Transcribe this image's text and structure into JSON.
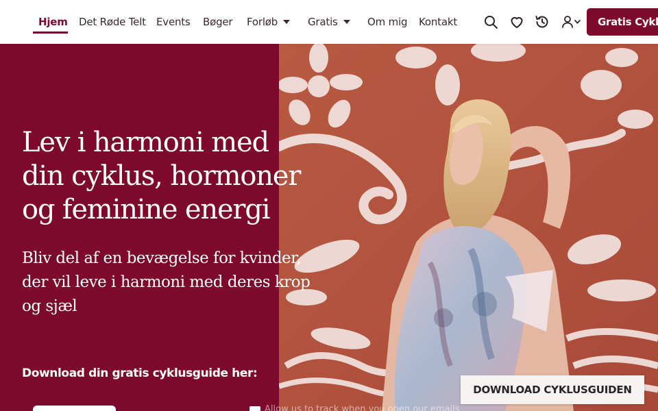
{
  "nav": {
    "items": [
      {
        "label": "Hjem",
        "active": true
      },
      {
        "label": "Det Røde Telt"
      },
      {
        "label": "Events"
      },
      {
        "label": "Bøger"
      },
      {
        "label": "Forløb",
        "dropdown": true
      },
      {
        "label": "Gratis",
        "dropdown": true
      },
      {
        "label": "Om mig"
      },
      {
        "label": "Kontakt"
      }
    ],
    "icons": [
      "search-icon",
      "heart-icon",
      "history-icon",
      "user-icon"
    ],
    "cta_label": "Gratis Cyklus"
  },
  "hero": {
    "title": "Lev i harmoni med din cyklus, hormoner og feminine energi",
    "subtitle": "Bliv del af en bevægelse for kvinder, der vil leve i harmoni med deres krop og sjæl",
    "download_label": "Download din gratis cyklusguide her:",
    "consent_text": "Allow us to track when you open our emails",
    "download_button": "DOWNLOAD CYKLUSGUIDEN"
  },
  "colors": {
    "brand": "#7d0a2c",
    "wall_red": "#b5533d",
    "pattern_light": "#f3e3e0"
  }
}
